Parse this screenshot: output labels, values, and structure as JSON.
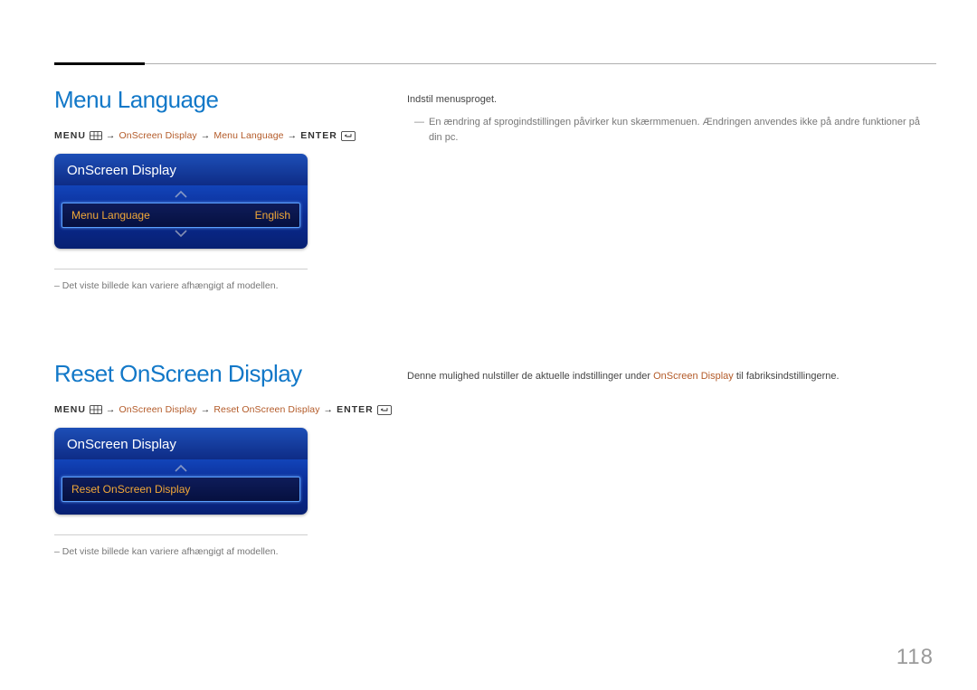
{
  "pageNumber": "118",
  "section1": {
    "title": "Menu Language",
    "path": {
      "menuLabel": "MENU",
      "seg1": "OnScreen Display",
      "seg2": "Menu Language",
      "enterLabel": "ENTER"
    },
    "osd": {
      "header": "OnScreen Display",
      "row": {
        "label": "Menu Language",
        "value": "English"
      }
    },
    "footnote": "Det viste billede kan variere afhængigt af modellen.",
    "right": {
      "p1": "Indstil menusproget.",
      "note": "En ændring af sprogindstillingen påvirker kun skærmmenuen. Ændringen anvendes ikke på andre funktioner på din pc."
    }
  },
  "section2": {
    "title": "Reset OnScreen Display",
    "path": {
      "menuLabel": "MENU",
      "seg1": "OnScreen Display",
      "seg2": "Reset OnScreen Display",
      "enterLabel": "ENTER"
    },
    "osd": {
      "header": "OnScreen Display",
      "row": {
        "label": "Reset OnScreen Display"
      }
    },
    "footnote": "Det viste billede kan variere afhængigt af modellen.",
    "right": {
      "p1_pre": "Denne mulighed nulstiller de aktuelle indstillinger under ",
      "p1_link": "OnScreen Display",
      "p1_post": " til fabriksindstillingerne."
    }
  }
}
